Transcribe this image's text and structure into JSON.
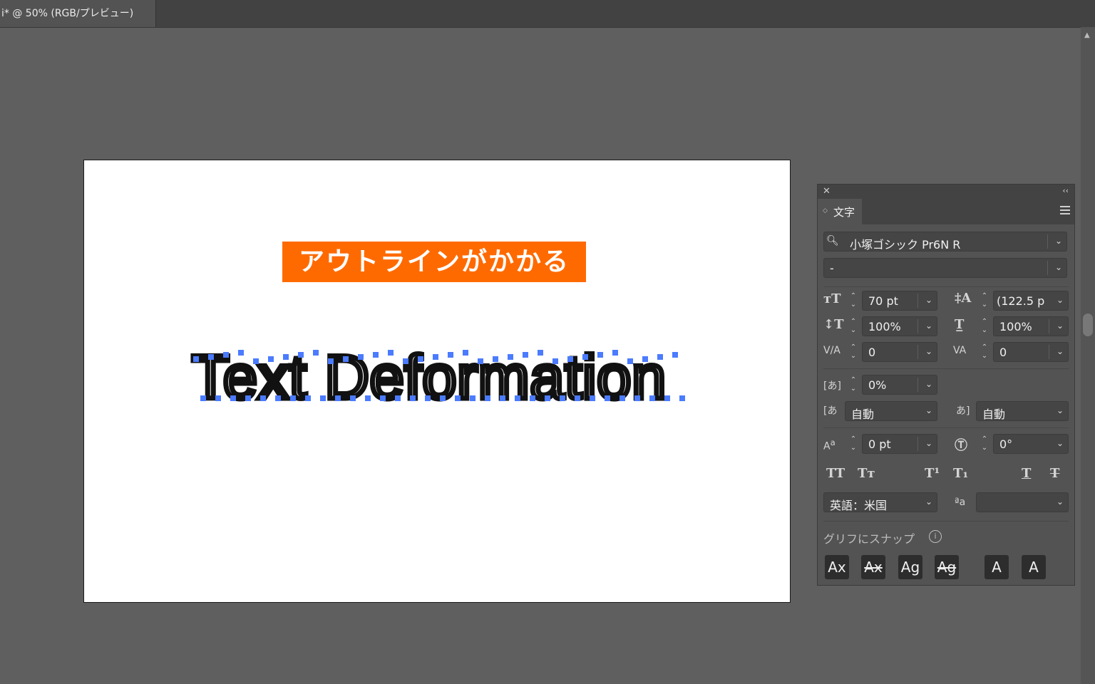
{
  "window": {
    "doc_tab_label": "i* @ 50% (RGB/プレビュー)"
  },
  "artboard": {
    "headline": "アウトラインがかかる",
    "outlined_text": "Text Deformation",
    "headline_color": "#ff6a00",
    "anchor_color": "#4b7bff"
  },
  "panel": {
    "tab_label": "文字",
    "font_family": "小塚ゴシック Pr6N R",
    "font_style": "-",
    "font_size": "70 pt",
    "leading": "(122.5 p",
    "vertical_scale": "100%",
    "horizontal_scale": "100%",
    "kerning": "0",
    "tracking": "0",
    "tsume": "0%",
    "aki_left": "自動",
    "aki_right": "自動",
    "baseline_shift": "0 pt",
    "rotation": "0°",
    "language": "英語：米国",
    "antialias": "",
    "snap_label": "グリフにスナップ",
    "glyph_buttons": [
      "Ax",
      "Ax",
      "Ag",
      "Ag",
      "A",
      "A"
    ]
  }
}
